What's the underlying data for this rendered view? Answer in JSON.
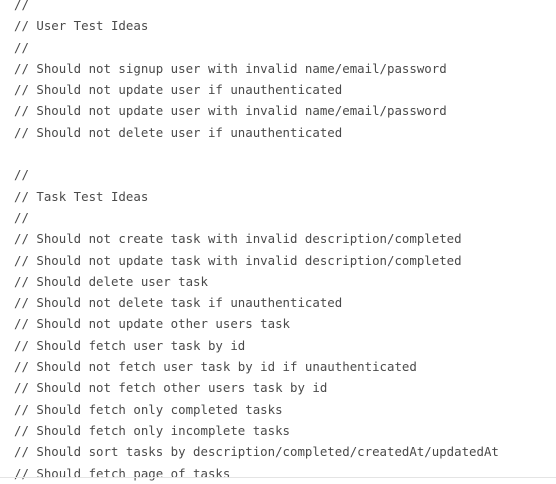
{
  "editor": {
    "lines": [
      "//",
      "// User Test Ideas",
      "//",
      "// Should not signup user with invalid name/email/password",
      "// Should not update user if unauthenticated",
      "// Should not update user with invalid name/email/password",
      "// Should not delete user if unauthenticated",
      "",
      "//",
      "// Task Test Ideas",
      "//",
      "// Should not create task with invalid description/completed",
      "// Should not update task with invalid description/completed",
      "// Should delete user task",
      "// Should not delete task if unauthenticated",
      "// Should not update other users task",
      "// Should fetch user task by id",
      "// Should not fetch user task by id if unauthenticated",
      "// Should not fetch other users task by id",
      "// Should fetch only completed tasks",
      "// Should fetch only incomplete tasks",
      "// Should sort tasks by description/completed/createdAt/updatedAt",
      "// Should fetch page of tasks"
    ]
  }
}
